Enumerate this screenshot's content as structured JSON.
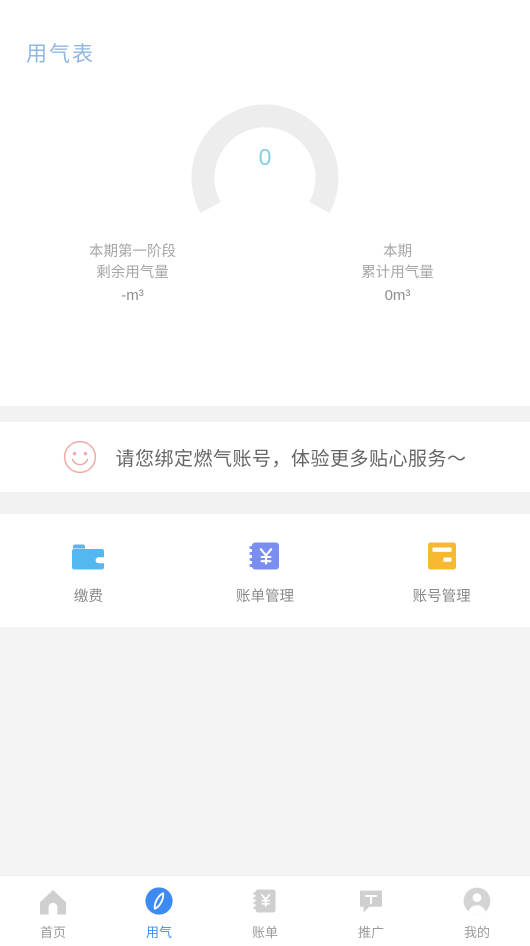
{
  "meter": {
    "title": "用气表",
    "gauge": {
      "value": "0",
      "value_color": "#84cfe4",
      "track_color": "#ededed",
      "progress_percent": 0
    },
    "stats": [
      {
        "line1": "本期第一阶段",
        "line2": "剩余用气量",
        "value": "-m³"
      },
      {
        "line1": "本期",
        "line2": "累计用气量",
        "value": "0m³"
      }
    ]
  },
  "bind_banner": {
    "icon": "smiley-icon",
    "icon_color": "#f0a9a9",
    "text": "请您绑定燃气账号，体验更多贴心服务～"
  },
  "actions": [
    {
      "icon": "wallet-icon",
      "label": "缴费",
      "color": "#53b8f0"
    },
    {
      "icon": "bill-book-icon",
      "label": "账单管理",
      "color": "#7b8ef0"
    },
    {
      "icon": "account-card-icon",
      "label": "账号管理",
      "color": "#f7b930"
    }
  ],
  "tabbar": {
    "active_index": 1,
    "active_color": "#3d8bf2",
    "inactive_color": "#cfcfcf",
    "items": [
      {
        "icon": "home-icon",
        "label": "首页"
      },
      {
        "icon": "compass-icon",
        "label": "用气"
      },
      {
        "icon": "bill-icon",
        "label": "账单"
      },
      {
        "icon": "promotion-icon",
        "label": "推广"
      },
      {
        "icon": "profile-icon",
        "label": "我的"
      }
    ]
  }
}
